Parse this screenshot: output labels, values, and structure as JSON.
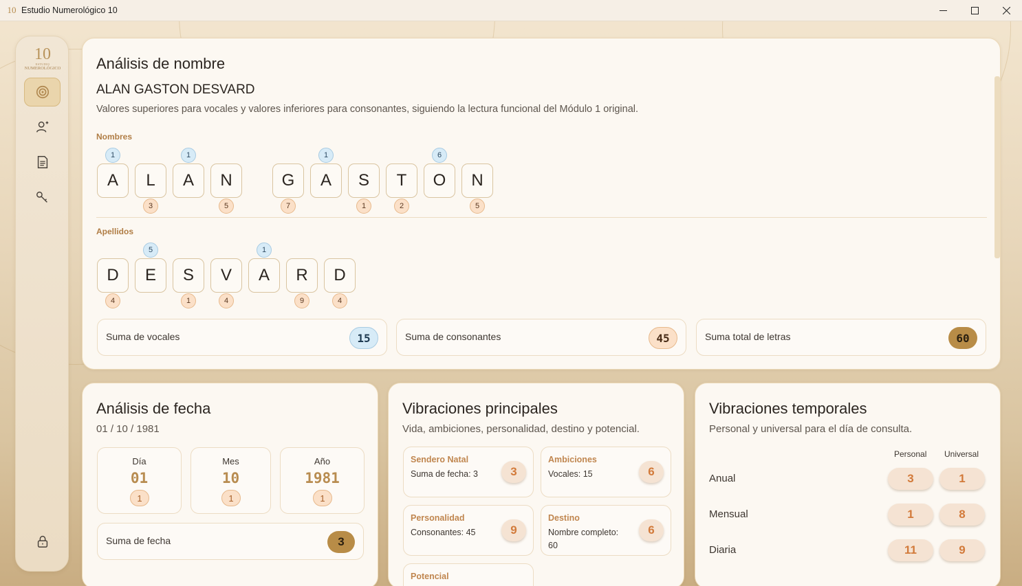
{
  "window": {
    "title": "Estudio Numerológico 10",
    "icon": "app-logo-icon",
    "controls": {
      "minimize": "—",
      "maximize": "☐",
      "close": "✕"
    }
  },
  "sidebar": {
    "logo": {
      "number": "10",
      "line1": "ESTUDIO",
      "line2": "NUMEROLÓGICO"
    },
    "items": [
      {
        "id": "analysis",
        "icon": "target-icon",
        "active": true
      },
      {
        "id": "profiles",
        "icon": "user-add-icon",
        "active": false
      },
      {
        "id": "reports",
        "icon": "document-icon",
        "active": false
      },
      {
        "id": "keys",
        "icon": "key-icon",
        "active": false
      },
      {
        "id": "lock",
        "icon": "lock-icon",
        "active": false
      }
    ]
  },
  "name_analysis": {
    "title": "Análisis de nombre",
    "full_name": "ALAN GASTON DESVARD",
    "description": "Valores superiores para vocales y valores inferiores para consonantes, siguiendo la lectura funcional del Módulo 1 original.",
    "nombres_label": "Nombres",
    "apellidos_label": "Apellidos",
    "nombres": [
      {
        "letter": "A",
        "vowel": "1",
        "consonant": ""
      },
      {
        "letter": "L",
        "vowel": "",
        "consonant": "3"
      },
      {
        "letter": "A",
        "vowel": "1",
        "consonant": ""
      },
      {
        "letter": "N",
        "vowel": "",
        "consonant": "5"
      },
      {
        "letter": "G",
        "vowel": "",
        "consonant": "7"
      },
      {
        "letter": "A",
        "vowel": "1",
        "consonant": ""
      },
      {
        "letter": "S",
        "vowel": "",
        "consonant": "1"
      },
      {
        "letter": "T",
        "vowel": "",
        "consonant": "2"
      },
      {
        "letter": "O",
        "vowel": "6",
        "consonant": ""
      },
      {
        "letter": "N",
        "vowel": "",
        "consonant": "5"
      }
    ],
    "apellidos": [
      {
        "letter": "D",
        "vowel": "",
        "consonant": "4"
      },
      {
        "letter": "E",
        "vowel": "5",
        "consonant": ""
      },
      {
        "letter": "S",
        "vowel": "",
        "consonant": "1"
      },
      {
        "letter": "V",
        "vowel": "",
        "consonant": "4"
      },
      {
        "letter": "A",
        "vowel": "1",
        "consonant": ""
      },
      {
        "letter": "R",
        "vowel": "",
        "consonant": "9"
      },
      {
        "letter": "D",
        "vowel": "",
        "consonant": "4"
      }
    ],
    "sums": {
      "vowels_label": "Suma de vocales",
      "vowels_value": "15",
      "consonants_label": "Suma de consonantes",
      "consonants_value": "45",
      "total_label": "Suma total de letras",
      "total_value": "60"
    }
  },
  "date_analysis": {
    "title": "Análisis de fecha",
    "date": "01 / 10 / 1981",
    "day_label": "Día",
    "day_value": "01",
    "day_reduced": "1",
    "month_label": "Mes",
    "month_value": "10",
    "month_reduced": "1",
    "year_label": "Año",
    "year_value": "1981",
    "year_reduced": "1",
    "sum_label": "Suma de fecha",
    "sum_value": "3"
  },
  "main_vibrations": {
    "title": "Vibraciones principales",
    "subtitle": "Vida, ambiciones, personalidad, destino y potencial.",
    "items": [
      {
        "title": "Sendero Natal",
        "desc": "Suma de fecha: 3",
        "value": "3"
      },
      {
        "title": "Ambiciones",
        "desc": "Vocales: 15",
        "value": "6"
      },
      {
        "title": "Personalidad",
        "desc": "Consonantes: 45",
        "value": "9"
      },
      {
        "title": "Destino",
        "desc": "Nombre completo: 60",
        "value": "6"
      }
    ],
    "partial_item": "Potencial"
  },
  "temporal_vibrations": {
    "title": "Vibraciones temporales",
    "subtitle": "Personal y universal para el día de consulta.",
    "col_personal": "Personal",
    "col_universal": "Universal",
    "rows": [
      {
        "label": "Anual",
        "personal": "3",
        "universal": "1"
      },
      {
        "label": "Mensual",
        "personal": "1",
        "universal": "8"
      },
      {
        "label": "Diaria",
        "personal": "11",
        "universal": "9"
      }
    ]
  },
  "colors": {
    "accent_gold": "#b88c47",
    "vowel_blue": "#d7ebf7",
    "consonant_peach": "#fbe0c8",
    "label_orange": "#c0864f"
  }
}
